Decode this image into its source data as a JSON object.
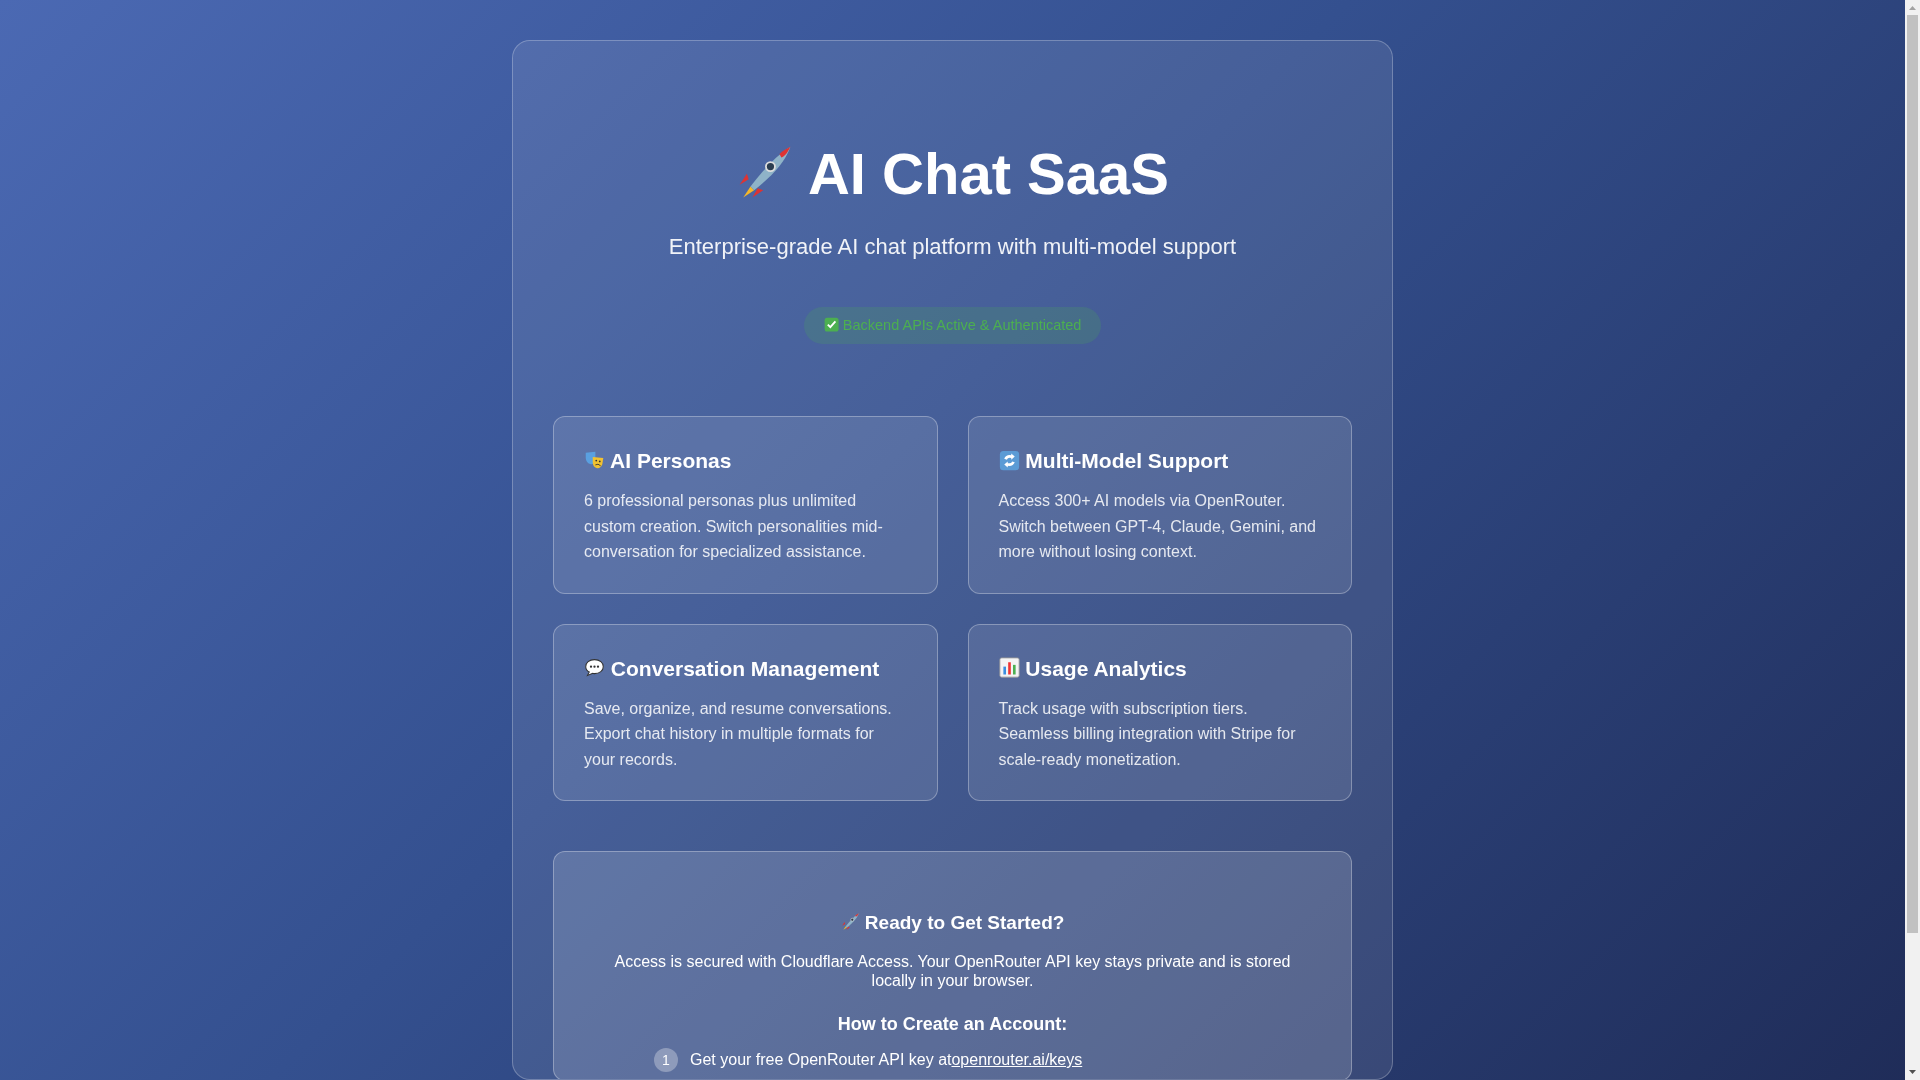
{
  "header": {
    "title": "AI Chat SaaS",
    "subtitle": "Enterprise-grade AI chat platform with multi-model support"
  },
  "status_badge": {
    "text": "Backend APIs Active & Authenticated"
  },
  "features": [
    {
      "title": "AI Personas",
      "description": "6 professional personas plus unlimited custom creation. Switch personalities mid-conversation for specialized assistance."
    },
    {
      "title": "Multi-Model Support",
      "description": "Access 300+ AI models via OpenRouter. Switch between GPT-4, Claude, Gemini, and more without losing context."
    },
    {
      "title": "Conversation Management",
      "description": "Save, organize, and resume conversations. Export chat history in multiple formats for your records."
    },
    {
      "title": "Usage Analytics",
      "description": "Track usage with subscription tiers. Seamless billing integration with Stripe for scale-ready monetization."
    }
  ],
  "get_started": {
    "title": "Ready to Get Started?",
    "description": "Access is secured with Cloudflare Access. Your OpenRouter API key stays private and is stored locally in your browser.",
    "steps_heading": "How to Create an Account:",
    "steps": [
      {
        "number": "1",
        "text": "Get your free OpenRouter API key at",
        "link": "openrouter.ai/keys"
      }
    ]
  }
}
